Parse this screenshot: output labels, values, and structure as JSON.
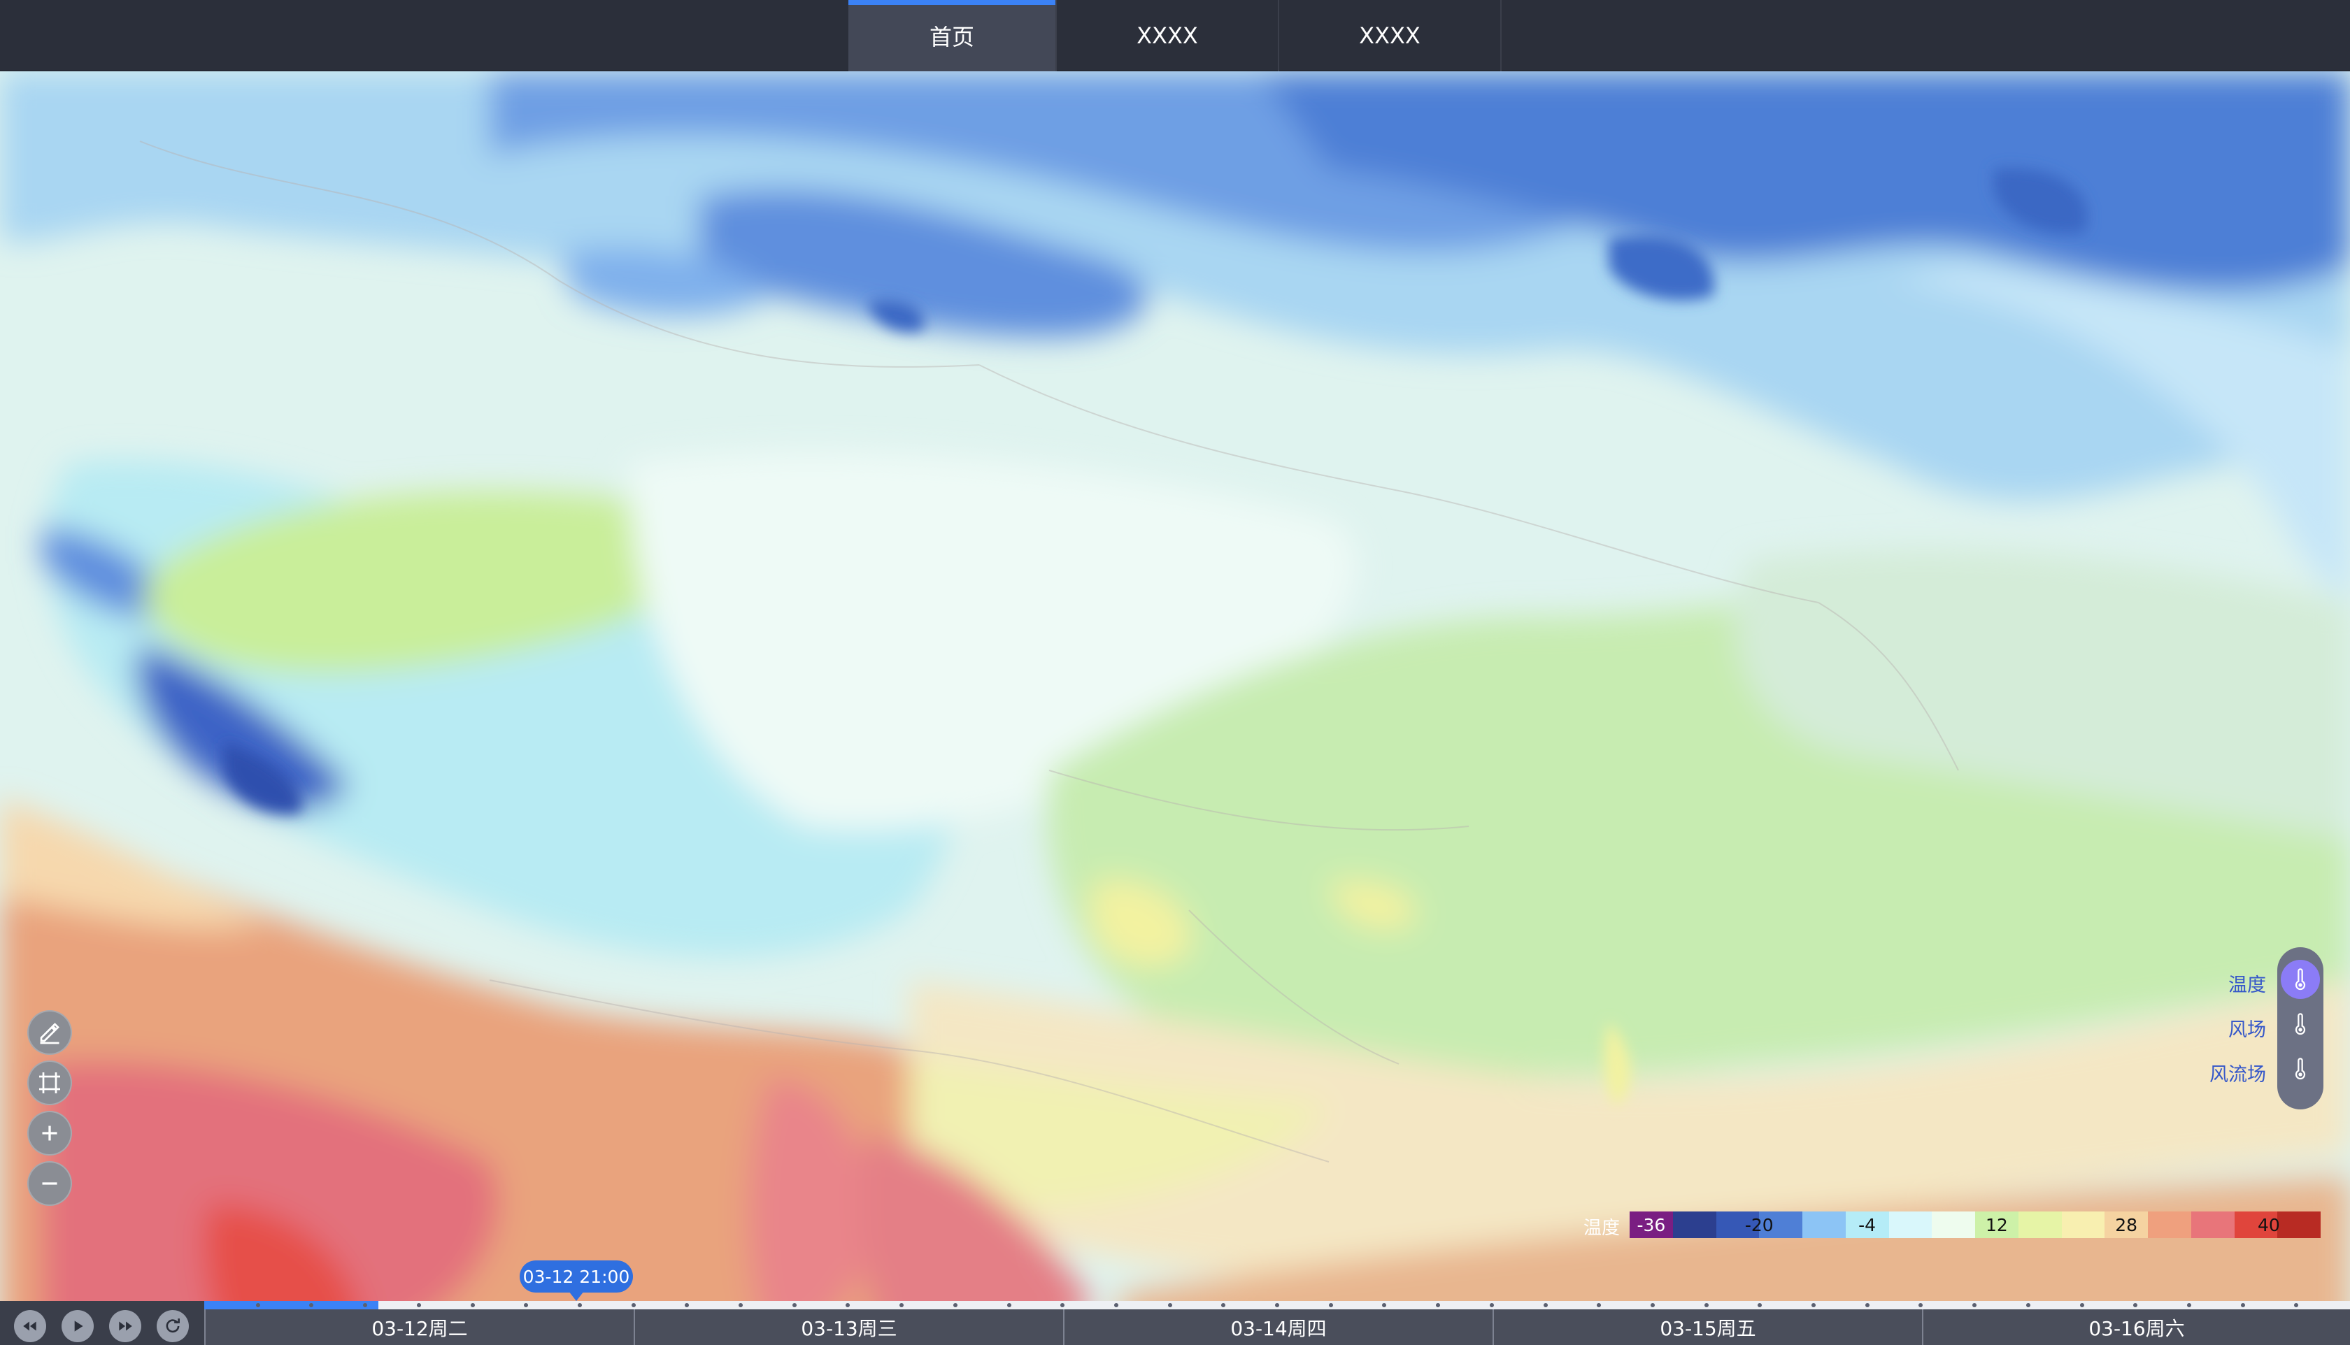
{
  "header": {
    "tabs": [
      {
        "label": "首页",
        "active": true
      },
      {
        "label": "XXXX",
        "active": false
      },
      {
        "label": "XXXX",
        "active": false
      }
    ]
  },
  "map": {
    "type": "temperature-contour",
    "tools": [
      {
        "name": "draw-tool",
        "icon": "pen-icon"
      },
      {
        "name": "select-area-tool",
        "icon": "crop-icon"
      },
      {
        "name": "zoom-in",
        "icon": "plus-icon"
      },
      {
        "name": "zoom-out",
        "icon": "minus-icon"
      }
    ]
  },
  "layers": {
    "items": [
      {
        "label": "温度",
        "icon": "thermometer-icon",
        "active": true
      },
      {
        "label": "风场",
        "icon": "thermometer-icon",
        "active": false
      },
      {
        "label": "风流场",
        "icon": "thermometer-icon",
        "active": false
      }
    ],
    "active_color": "#8b7cf6",
    "label_color": "#3557c9"
  },
  "legend": {
    "title": "温度",
    "colors": [
      "#7a1e82",
      "#2c3f8f",
      "#3658b6",
      "#4f7fd6",
      "#8cc4f5",
      "#b5ecf7",
      "#d9f7fb",
      "#eefcee",
      "#cdf1a8",
      "#e6f4a6",
      "#f8efb0",
      "#f5d3a1",
      "#efa07e",
      "#e8757a",
      "#e0453c",
      "#b82b23"
    ],
    "labels": [
      {
        "text": "-36",
        "slot": 0.5
      },
      {
        "text": "-20",
        "slot": 3.0
      },
      {
        "text": "-4",
        "slot": 5.5
      },
      {
        "text": "12",
        "slot": 8.5
      },
      {
        "text": "28",
        "slot": 11.5
      },
      {
        "text": "40",
        "slot": 14.8
      }
    ]
  },
  "timeline": {
    "current_time": "03-12 21:00",
    "progress": 0.081,
    "days": [
      "03-12周二",
      "03-13周三",
      "03-14周四",
      "03-15周五",
      "03-16周六"
    ],
    "controls": [
      {
        "name": "rewind-button",
        "icon": "rewind-icon"
      },
      {
        "name": "play-button",
        "icon": "play-icon"
      },
      {
        "name": "fast-forward-button",
        "icon": "fast-forward-icon"
      },
      {
        "name": "refresh-button",
        "icon": "refresh-icon"
      }
    ]
  }
}
